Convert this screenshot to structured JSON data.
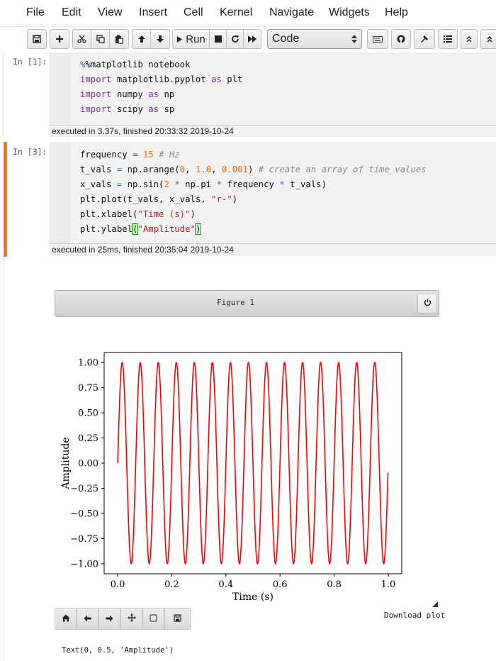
{
  "menubar": {
    "items": [
      "File",
      "Edit",
      "View",
      "Insert",
      "Cell",
      "Kernel",
      "Navigate",
      "Widgets",
      "Help"
    ]
  },
  "toolbar": {
    "run_label": "Run",
    "cell_type": "Code",
    "icons": [
      "save-icon",
      "plus-icon",
      "cut-icon",
      "copy-icon",
      "paste-icon",
      "arrow-up-icon",
      "arrow-down-icon",
      "play-icon",
      "stop-icon",
      "restart-icon",
      "fast-forward-icon",
      "keyboard-icon",
      "github-icon",
      "wrench-icon",
      "list-icon",
      "chevrons-up-icon",
      "chevrons-up-icon"
    ]
  },
  "cells": [
    {
      "prompt": "In [1]:",
      "lines": [
        "%matplotlib notebook",
        "import matplotlib.pyplot as plt",
        "import numpy as np",
        "import scipy as sp"
      ],
      "exec": "executed in 3.37s, finished 20:33:32 2019-10-24"
    },
    {
      "prompt": "In [3]:",
      "lines": [
        "frequency = 15 # Hz",
        "t_vals = np.arange(0, 1.0, 0.001) # create an array of time values",
        "x_vals = np.sin(2 * np.pi * frequency * t_vals)",
        "plt.plot(t_vals, x_vals, \"r-\")",
        "plt.xlabel(\"Time (s)\")",
        "plt.ylabel(\"Amplitude\")"
      ],
      "exec": "executed in 25ms, finished 20:35:04 2019-10-24"
    }
  ],
  "figure": {
    "title": "Figure 1",
    "download_label": "Download plot",
    "output_text": "Text(0, 0.5, 'Amplitude')",
    "toolbar_icons": [
      "home-icon",
      "back-icon",
      "forward-icon",
      "pan-icon",
      "zoom-rect-icon",
      "save-figure-icon"
    ]
  },
  "chart_data": {
    "type": "line",
    "function": "sin(2*pi*15*t)",
    "frequency_hz": 15,
    "x_start": 0,
    "x_stop": 1.0,
    "x_step": 0.001,
    "line_color": "#ff0000",
    "xlabel": "Time (s)",
    "ylabel": "Amplitude",
    "xlim": [
      -0.05,
      1.05
    ],
    "ylim": [
      -1.1,
      1.1
    ],
    "xticks": [
      0.0,
      0.2,
      0.4,
      0.6,
      0.8,
      1.0
    ],
    "xtick_labels": [
      "0.0",
      "0.2",
      "0.4",
      "0.6",
      "0.8",
      "1.0"
    ],
    "yticks": [
      1.0,
      0.75,
      0.5,
      0.25,
      0.0,
      -0.25,
      -0.5,
      -0.75,
      -1.0
    ],
    "ytick_labels": [
      "1.00",
      "0.75",
      "0.50",
      "0.25",
      "0.00",
      "−0.25",
      "−0.50",
      "−0.75",
      "−1.00"
    ],
    "grid": false
  }
}
